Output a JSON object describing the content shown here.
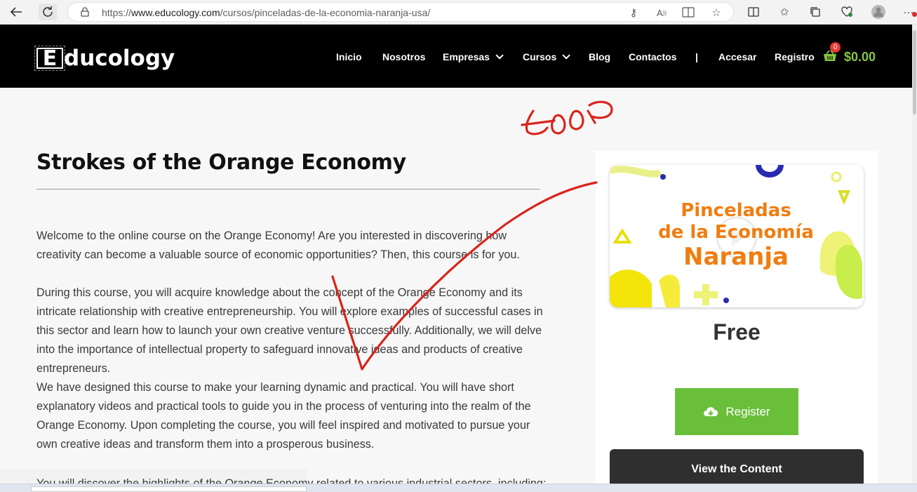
{
  "browser": {
    "url_prefix": "https://",
    "url_domain": "www.educology.com",
    "url_path": "/cursos/pinceladas-de-la-economia-naranja-usa/"
  },
  "site": {
    "logo_letter": "E",
    "logo_rest": "ducology",
    "nav": [
      {
        "label": "Inicio"
      },
      {
        "label": "Nosotros"
      },
      {
        "label": "Empresas"
      },
      {
        "label": "Cursos"
      },
      {
        "label": "Blog"
      },
      {
        "label": "Contactos"
      },
      {
        "label": "|"
      },
      {
        "label": "Accesar"
      },
      {
        "label": "Registro"
      }
    ],
    "cart_count": "0",
    "cart_total": "$0.00"
  },
  "course": {
    "title": "Strokes of the Orange Economy",
    "paragraphs": [
      "Welcome to the online course on the Orange Economy! Are you interested in discovering how creativity can become a valuable source of economic opportunities? Then, this course is for you.",
      "During this course, you will acquire knowledge about the concept of the Orange Economy and its intricate relationship with creative entrepreneurship. You will explore examples of successful cases in this sector and learn how to launch your own creative venture successfully. Additionally, we will delve into the importance of intellectual property to safeguard innovative ideas and products of creative entrepreneurs.",
      "We have designed this course to make your learning dynamic and practical. You will have short explanatory videos and practical tools to guide you in the process of venturing into the realm of the Orange Economy. Upon completing the course, you will feel inspired and motivated to pursue your own creative ideas and transform them into a prosperous business."
    ],
    "cut_paragraph": "You will discover the highlights of the Orange Economy related to various industrial sectors, including:",
    "thumbnail_line1": "Pinceladas",
    "thumbnail_line2": "de la Economía",
    "thumbnail_line3": "Naranja",
    "price": "Free",
    "register_label": "Register",
    "view_label": "View the Content"
  },
  "annotation": {
    "handwriting": "GOOD",
    "color": "#d9241c"
  },
  "colors": {
    "accent_green": "#6abf3a",
    "cart_green": "#86c540",
    "thumb_orange": "#f07d10"
  }
}
